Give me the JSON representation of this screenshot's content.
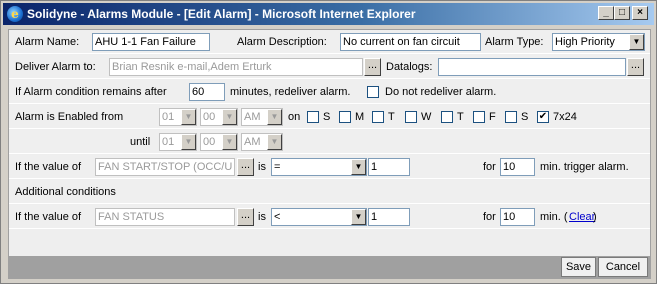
{
  "window": {
    "title": "Solidyne - Alarms Module - [Edit Alarm] - Microsoft Internet Explorer",
    "minimize": "_",
    "maximize": "□",
    "close": "×"
  },
  "row1": {
    "alarm_name_label": "Alarm Name:",
    "alarm_name_value": "AHU 1-1 Fan Failure",
    "alarm_desc_label": "Alarm Description:",
    "alarm_desc_value": "No current on fan circuit",
    "alarm_type_label": "Alarm Type:",
    "alarm_type_value": "High Priority"
  },
  "row2": {
    "deliver_label": "Deliver Alarm to:",
    "deliver_value": "Brian Resnik e-mail,Adem Erturk",
    "datalogs_label": "Datalogs:",
    "datalogs_value": "",
    "browse": "..."
  },
  "row3": {
    "prefix": "If Alarm condition remains after",
    "minutes_value": "60",
    "suffix": "minutes, redeliver alarm.",
    "no_redeliver_label": "Do not redeliver alarm."
  },
  "row4": {
    "enabled_from_label": "Alarm is Enabled from",
    "from_hour": "01",
    "from_min": "00",
    "from_ampm": "AM",
    "on_label": "on",
    "days": [
      "S",
      "M",
      "T",
      "W",
      "T",
      "F",
      "S"
    ],
    "all_week_label": "7x24",
    "all_week_checked": "✔"
  },
  "row5": {
    "until_label": "until",
    "until_hour": "01",
    "until_min": "00",
    "until_ampm": "AM"
  },
  "row6": {
    "if_value_label": "If the value of",
    "point_value": "FAN START/STOP (OCC/U",
    "is_label": "is",
    "operator": "=",
    "compare_value": "1",
    "for_label": "for",
    "minutes_value": "10",
    "trigger_label": "min. trigger alarm."
  },
  "row7": {
    "additional_label": "Additional conditions"
  },
  "row8": {
    "if_value_label": "If the value of",
    "point_value": "FAN STATUS",
    "is_label": "is",
    "operator": "<",
    "compare_value": "1",
    "for_label": "for",
    "minutes_value": "10",
    "min_label": "min. (",
    "clear_label": "Clear",
    "close_paren": ")"
  },
  "footer": {
    "save_label": "Save",
    "cancel_label": "Cancel"
  }
}
